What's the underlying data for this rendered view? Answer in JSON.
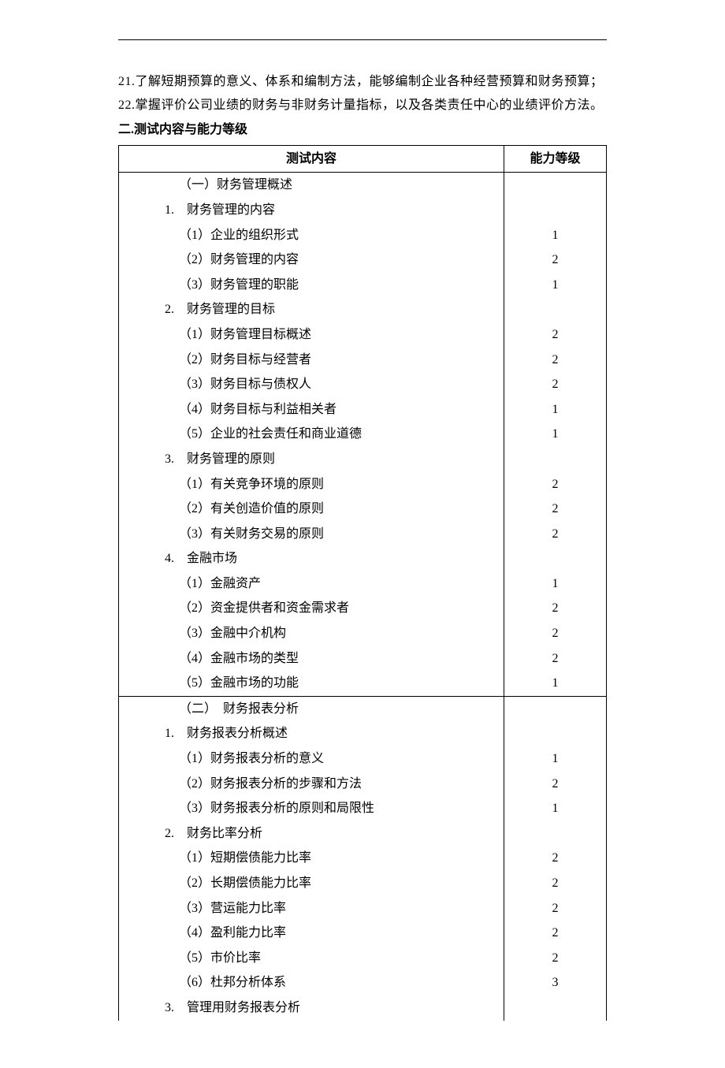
{
  "intro": {
    "line1": "21.了解短期预算的意义、体系和编制方法，能够编制企业各种经营预算和财务预算；",
    "line2": "22.掌握评价公司业绩的财务与非财务计量指标，以及各类责任中心的业绩评价方法。"
  },
  "heading": "二.测试内容与能力等级",
  "headers": {
    "col1": "测试内容",
    "col2": "能力等级"
  },
  "rows": [
    {
      "text": "（一）财务管理概述",
      "level": "",
      "cls": "indent-section",
      "sep": false
    },
    {
      "text": "1.　财务管理的内容",
      "level": "",
      "cls": "indent-num",
      "sep": false
    },
    {
      "text": "（1）企业的组织形式",
      "level": "1",
      "cls": "indent-sub",
      "sep": false
    },
    {
      "text": "（2）财务管理的内容",
      "level": "2",
      "cls": "indent-sub",
      "sep": false
    },
    {
      "text": "（3）财务管理的职能",
      "level": "1",
      "cls": "indent-sub",
      "sep": false
    },
    {
      "text": "2.　财务管理的目标",
      "level": "",
      "cls": "indent-num",
      "sep": false
    },
    {
      "text": "（1）财务管理目标概述",
      "level": "2",
      "cls": "indent-sub",
      "sep": false
    },
    {
      "text": "（2）财务目标与经营者",
      "level": "2",
      "cls": "indent-sub",
      "sep": false
    },
    {
      "text": "（3）财务目标与债权人",
      "level": "2",
      "cls": "indent-sub",
      "sep": false
    },
    {
      "text": "（4）财务目标与利益相关者",
      "level": "1",
      "cls": "indent-sub",
      "sep": false
    },
    {
      "text": "（5）企业的社会责任和商业道德",
      "level": "1",
      "cls": "indent-sub",
      "sep": false
    },
    {
      "text": "3.　财务管理的原则",
      "level": "",
      "cls": "indent-num",
      "sep": false
    },
    {
      "text": "（1）有关竞争环境的原则",
      "level": "2",
      "cls": "indent-sub",
      "sep": false
    },
    {
      "text": "（2）有关创造价值的原则",
      "level": "2",
      "cls": "indent-sub",
      "sep": false
    },
    {
      "text": "（3）有关财务交易的原则",
      "level": "2",
      "cls": "indent-sub",
      "sep": false
    },
    {
      "text": "4.　金融市场",
      "level": "",
      "cls": "indent-num",
      "sep": false
    },
    {
      "text": "（1）金融资产",
      "level": "1",
      "cls": "indent-sub",
      "sep": false
    },
    {
      "text": "（2）资金提供者和资金需求者",
      "level": "2",
      "cls": "indent-sub",
      "sep": false
    },
    {
      "text": "（3）金融中介机构",
      "level": "2",
      "cls": "indent-sub",
      "sep": false
    },
    {
      "text": "（4）金融市场的类型",
      "level": "2",
      "cls": "indent-sub",
      "sep": false
    },
    {
      "text": "（5）金融市场的功能",
      "level": "1",
      "cls": "indent-sub",
      "sep": false
    },
    {
      "text": "（二）　财务报表分析",
      "level": "",
      "cls": "indent-section",
      "sep": true
    },
    {
      "text": "1.　财务报表分析概述",
      "level": "",
      "cls": "indent-num",
      "sep": false
    },
    {
      "text": "（1）财务报表分析的意义",
      "level": "1",
      "cls": "indent-sub",
      "sep": false
    },
    {
      "text": "（2）财务报表分析的步骤和方法",
      "level": "2",
      "cls": "indent-sub",
      "sep": false
    },
    {
      "text": "（3）财务报表分析的原则和局限性",
      "level": "1",
      "cls": "indent-sub",
      "sep": false
    },
    {
      "text": "2.　财务比率分析",
      "level": "",
      "cls": "indent-num",
      "sep": false
    },
    {
      "text": "（1）短期偿债能力比率",
      "level": "2",
      "cls": "indent-sub",
      "sep": false
    },
    {
      "text": "（2）长期偿债能力比率",
      "level": "2",
      "cls": "indent-sub",
      "sep": false
    },
    {
      "text": "（3）营运能力比率",
      "level": "2",
      "cls": "indent-sub",
      "sep": false
    },
    {
      "text": "（4）盈利能力比率",
      "level": "2",
      "cls": "indent-sub",
      "sep": false
    },
    {
      "text": "（5）市价比率",
      "level": "2",
      "cls": "indent-sub",
      "sep": false
    },
    {
      "text": "（6）杜邦分析体系",
      "level": "3",
      "cls": "indent-sub",
      "sep": false
    },
    {
      "text": "3.　管理用财务报表分析",
      "level": "",
      "cls": "indent-num",
      "sep": false
    }
  ]
}
